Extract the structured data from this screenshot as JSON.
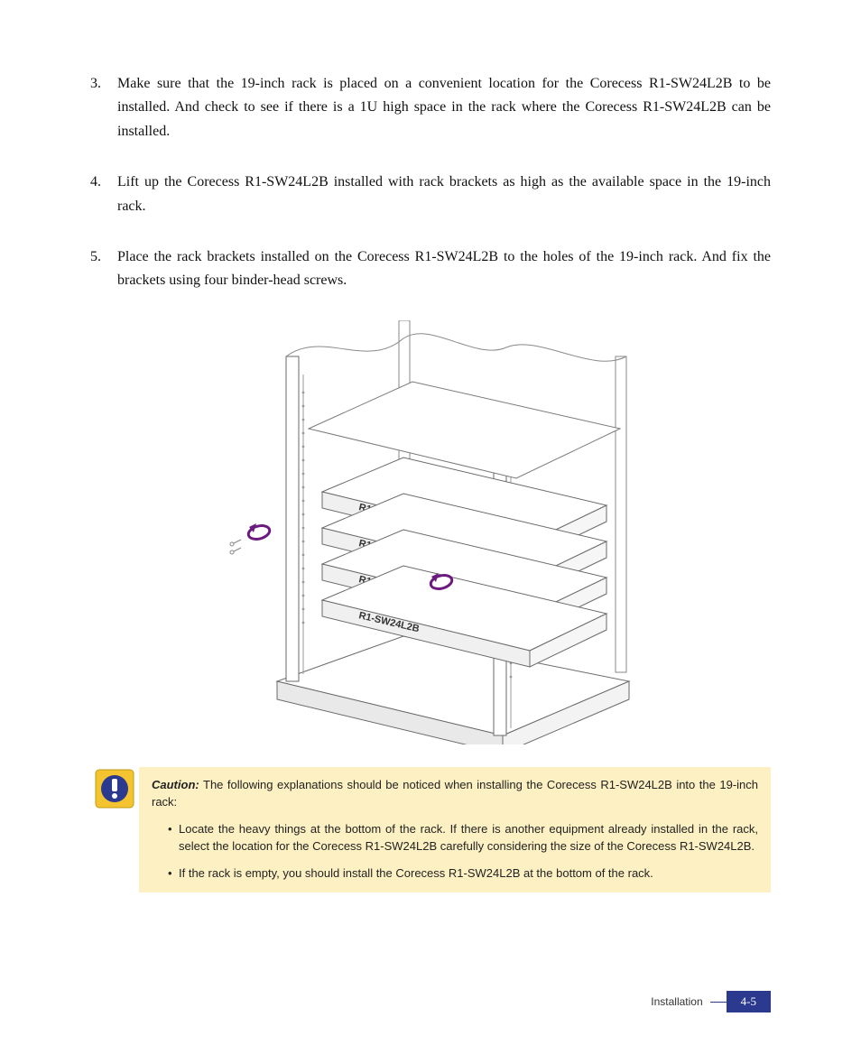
{
  "steps": [
    {
      "n": "3.",
      "text": "Make sure that the 19-inch rack is placed on a convenient location for the Corecess R1-SW24L2B to be installed. And check to see if there is a 1U high space in the rack where the Corecess R1-SW24L2B can be installed."
    },
    {
      "n": "4.",
      "text": "Lift up the Corecess R1-SW24L2B installed with rack brackets as high as the available space in the 19-inch rack."
    },
    {
      "n": "5.",
      "text": "Place the rack brackets installed on the Corecess R1-SW24L2B to the holes of the 19-inch rack. And fix the brackets using four binder-head screws."
    }
  ],
  "figure": {
    "device_labels": [
      "R1-SW24L2B",
      "R1-SW24L2B",
      "R1-SW24L2B",
      "R1-SW24L2B"
    ]
  },
  "caution": {
    "title": "Caution:",
    "lead": "The following explanations should be noticed when installing the Corecess R1-SW24L2B into the 19-inch rack:",
    "items": [
      "Locate the heavy things at the bottom of the rack. If there is another equipment already installed in the rack, select the location for the Corecess R1-SW24L2B carefully considering the size of the Corecess R1-SW24L2B.",
      "If the rack is empty, you should install the Corecess R1-SW24L2B at the bottom of the rack."
    ]
  },
  "footer": {
    "section": "Installation",
    "page": "4-5"
  }
}
